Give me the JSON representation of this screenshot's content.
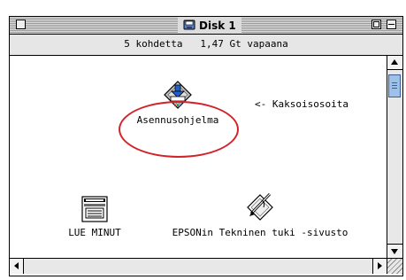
{
  "window": {
    "title": "Disk 1",
    "info": "5 kohdetta   1,47 Gt vapaana"
  },
  "items": [
    {
      "label": "Asennusohjelma",
      "icon": "installer-icon"
    },
    {
      "label": "LUE MINUT",
      "icon": "readme-document-icon"
    },
    {
      "label": "EPSONin Tekninen tuki -sivusto",
      "icon": "web-link-icon"
    }
  ],
  "callout": "<- Kaksoisosoita",
  "colors": {
    "highlight_ellipse": "#d2232a",
    "scroll_thumb": "#9ec1ea"
  }
}
